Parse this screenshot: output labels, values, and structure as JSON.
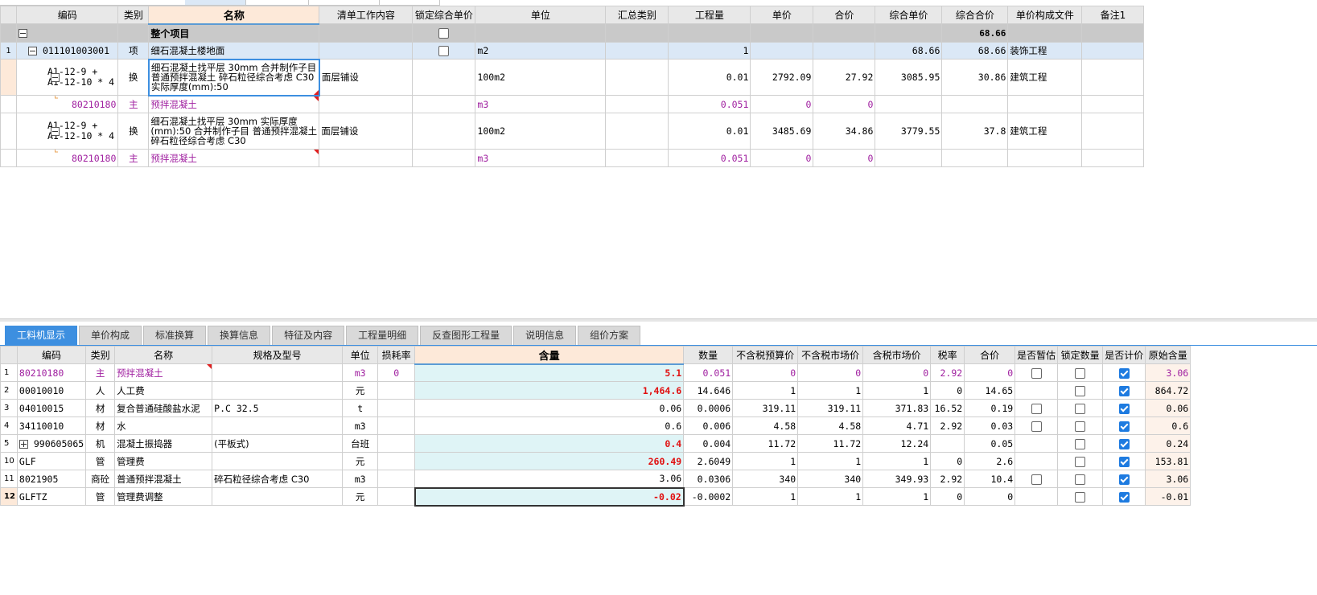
{
  "upper": {
    "headers": [
      "编码",
      "类别",
      "名称",
      "清单工作内容",
      "锁定综合单价",
      "单位",
      "汇总类别",
      "工程量",
      "单价",
      "合价",
      "综合单价",
      "综合合价",
      "单价构成文件",
      "备注1"
    ],
    "summary": {
      "label": "整个项目",
      "total": "68.66"
    },
    "rows": [
      {
        "num": "1",
        "code": "011101003001",
        "type": "项",
        "name": "细石混凝土楼地面",
        "unit": "m2",
        "qty": "1",
        "unit_price": "",
        "total": "",
        "comp_unit": "68.66",
        "comp_total": "68.66",
        "file": "装饰工程",
        "content": ""
      },
      {
        "num": "",
        "code": "A1-12-9 + A1-12-10 * 4",
        "type": "换",
        "name": "细石混凝土找平层 30mm  合并制作子目 普通预拌混凝土 碎石粒径综合考虑 C30  实际厚度(mm):50",
        "unit": "100m2",
        "qty": "0.01",
        "unit_price": "2792.09",
        "total": "27.92",
        "comp_unit": "3085.95",
        "comp_total": "30.86",
        "file": "建筑工程",
        "content": "面层铺设"
      },
      {
        "num": "",
        "code": "80210180",
        "type": "主",
        "name": "预拌混凝土",
        "unit": "m3",
        "qty": "0.051",
        "unit_price": "0",
        "total": "0",
        "comp_unit": "",
        "comp_total": "",
        "file": "",
        "content": ""
      },
      {
        "num": "",
        "code": "A1-12-9 + A1-12-10 * 4",
        "type": "换",
        "name": "细石混凝土找平层 30mm  实际厚度(mm):50  合并制作子目 普通预拌混凝土 碎石粒径综合考虑 C30",
        "unit": "100m2",
        "qty": "0.01",
        "unit_price": "3485.69",
        "total": "34.86",
        "comp_unit": "3779.55",
        "comp_total": "37.8",
        "file": "建筑工程",
        "content": "面层铺设"
      },
      {
        "num": "",
        "code": "80210180",
        "type": "主",
        "name": "预拌混凝土",
        "unit": "m3",
        "qty": "0.051",
        "unit_price": "0",
        "total": "0",
        "comp_unit": "",
        "comp_total": "",
        "file": "",
        "content": ""
      }
    ]
  },
  "tabs": [
    "工料机显示",
    "单价构成",
    "标准换算",
    "换算信息",
    "特征及内容",
    "工程量明细",
    "反查图形工程量",
    "说明信息",
    "组价方案"
  ],
  "lower": {
    "headers": [
      "编码",
      "类别",
      "名称",
      "规格及型号",
      "单位",
      "损耗率",
      "含量",
      "数量",
      "不含税预算价",
      "不含税市场价",
      "含税市场价",
      "税率",
      "合价",
      "是否暂估",
      "锁定数量",
      "是否计价",
      "原始含量"
    ],
    "rows": [
      {
        "num": "1",
        "code": "80210180",
        "type": "主",
        "name": "预拌混凝土",
        "spec": "",
        "unit": "m3",
        "loss": "0",
        "content": "5.1",
        "qty": "0.051",
        "budget": "0",
        "market": "0",
        "market_tax": "0",
        "tax": "2.92",
        "total": "0",
        "orig": "3.06"
      },
      {
        "num": "2",
        "code": "00010010",
        "type": "人",
        "name": "人工费",
        "spec": "",
        "unit": "元",
        "loss": "",
        "content": "1,464.6",
        "qty": "14.646",
        "budget": "1",
        "market": "1",
        "market_tax": "1",
        "tax": "0",
        "total": "14.65",
        "orig": "864.72"
      },
      {
        "num": "3",
        "code": "04010015",
        "type": "材",
        "name": "复合普通硅酸盐水泥",
        "spec": "P.C 32.5",
        "unit": "t",
        "loss": "",
        "content": "0.06",
        "qty": "0.0006",
        "budget": "319.11",
        "market": "319.11",
        "market_tax": "371.83",
        "tax": "16.52",
        "total": "0.19",
        "orig": "0.06"
      },
      {
        "num": "4",
        "code": "34110010",
        "type": "材",
        "name": "水",
        "spec": "",
        "unit": "m3",
        "loss": "",
        "content": "0.6",
        "qty": "0.006",
        "budget": "4.58",
        "market": "4.58",
        "market_tax": "4.71",
        "tax": "2.92",
        "total": "0.03",
        "orig": "0.6"
      },
      {
        "num": "5",
        "code": "990605065",
        "type": "机",
        "name": "混凝土振捣器",
        "spec": "(平板式)",
        "unit": "台班",
        "loss": "",
        "content": "0.4",
        "qty": "0.004",
        "budget": "11.72",
        "market": "11.72",
        "market_tax": "12.24",
        "tax": "",
        "total": "0.05",
        "orig": "0.24"
      },
      {
        "num": "10",
        "code": "GLF",
        "type": "管",
        "name": "管理费",
        "spec": "",
        "unit": "元",
        "loss": "",
        "content": "260.49",
        "qty": "2.6049",
        "budget": "1",
        "market": "1",
        "market_tax": "1",
        "tax": "0",
        "total": "2.6",
        "orig": "153.81"
      },
      {
        "num": "11",
        "code": "8021905",
        "type": "商砼",
        "name": "普通预拌混凝土",
        "spec": "碎石粒径综合考虑 C30",
        "unit": "m3",
        "loss": "",
        "content": "3.06",
        "qty": "0.0306",
        "budget": "340",
        "market": "340",
        "market_tax": "349.93",
        "tax": "2.92",
        "total": "10.4",
        "orig": "3.06"
      },
      {
        "num": "12",
        "code": "GLFTZ",
        "type": "管",
        "name": "管理费调整",
        "spec": "",
        "unit": "元",
        "loss": "",
        "content": "-0.02",
        "qty": "-0.0002",
        "budget": "1",
        "market": "1",
        "market_tax": "1",
        "tax": "0",
        "total": "0",
        "orig": "-0.01"
      }
    ]
  }
}
